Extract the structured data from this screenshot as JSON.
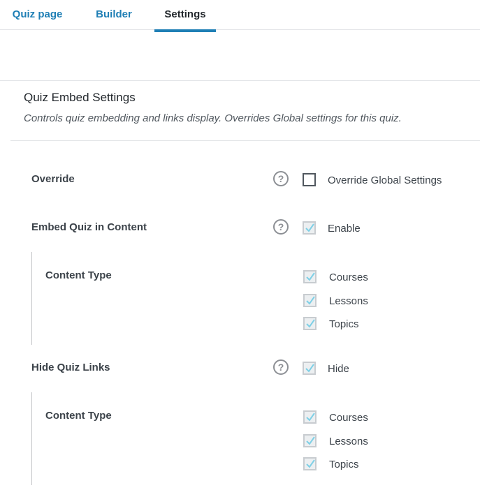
{
  "tabs": [
    {
      "label": "Quiz page"
    },
    {
      "label": "Builder"
    },
    {
      "label": "Settings"
    }
  ],
  "section": {
    "title": "Quiz Embed Settings",
    "description": "Controls quiz embedding and links display. Overrides Global settings for this quiz."
  },
  "override": {
    "label": "Override",
    "help_icon": "question-circle-icon",
    "checkbox_label": "Override Global Settings",
    "checked": false
  },
  "embed": {
    "label": "Embed Quiz in Content",
    "help_icon": "question-circle-icon",
    "checkbox_label": "Enable",
    "checked": true,
    "content_type_label": "Content Type",
    "options": [
      {
        "label": "Courses",
        "checked": true
      },
      {
        "label": "Lessons",
        "checked": true
      },
      {
        "label": "Topics",
        "checked": true
      }
    ]
  },
  "hide_links": {
    "label": "Hide Quiz Links",
    "help_icon": "question-circle-icon",
    "checkbox_label": "Hide",
    "checked": true,
    "content_type_label": "Content Type",
    "options": [
      {
        "label": "Courses",
        "checked": true
      },
      {
        "label": "Lessons",
        "checked": true
      },
      {
        "label": "Topics",
        "checked": true
      }
    ]
  },
  "colors": {
    "accent": "#1f7fb5",
    "check_mark": "#7fd0e6"
  }
}
